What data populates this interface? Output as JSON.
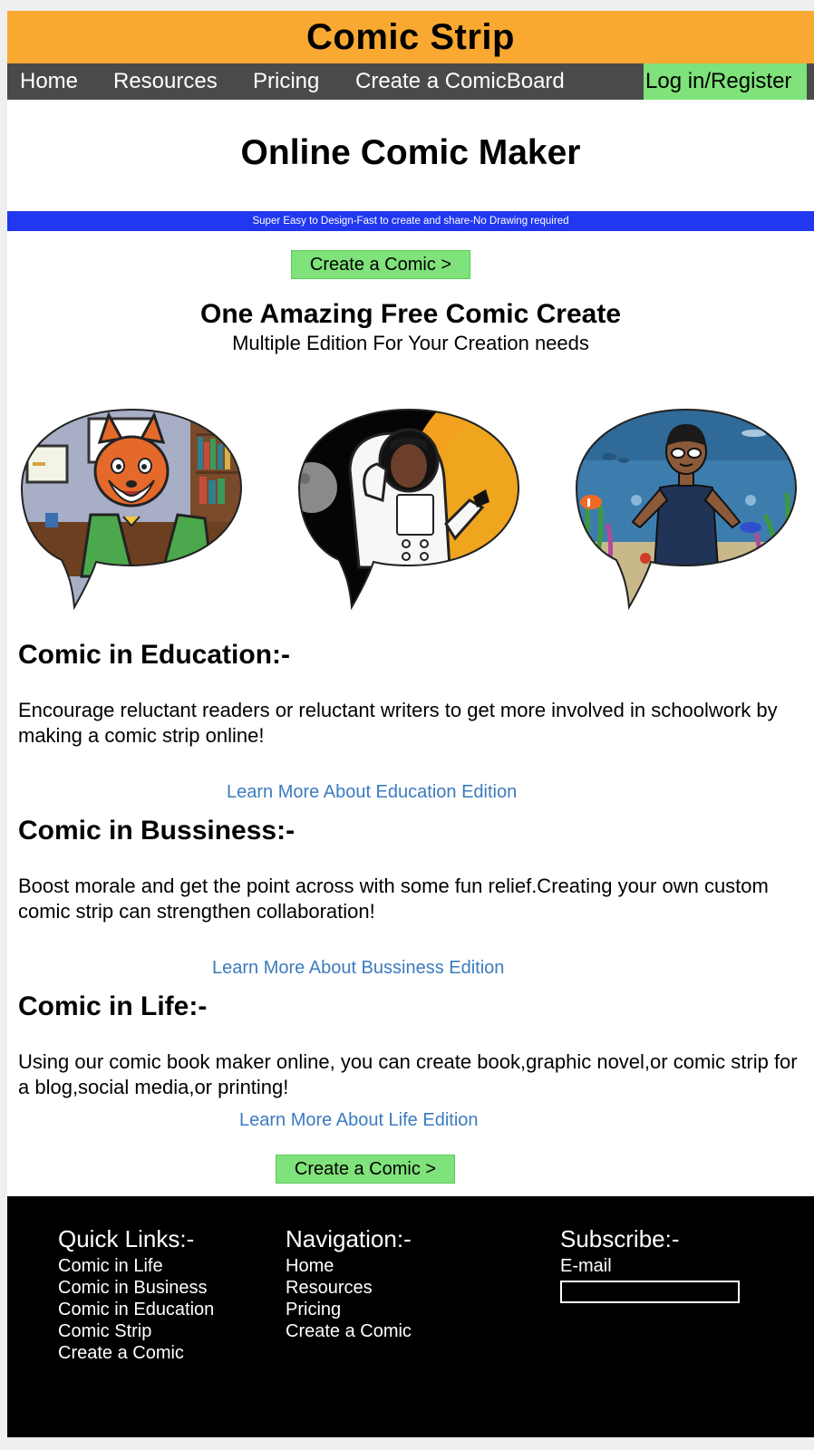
{
  "site_title": "Comic Strip",
  "nav": {
    "home": "Home",
    "resources": "Resources",
    "pricing": "Pricing",
    "create_board": "Create a ComicBoard",
    "login": "Log in/Register"
  },
  "hero": {
    "title": "Online Comic Maker",
    "tagline": "Super Easy to Design-Fast to create and share-No Drawing required",
    "cta": "Create a Comic >"
  },
  "intro": {
    "title": "One Amazing Free Comic Create",
    "subtitle": "Multiple Edition For Your Creation needs"
  },
  "categories": {
    "education": {
      "heading": "Comic in Education:-",
      "text": "Encourage reluctant readers or reluctant writers to get more involved in schoolwork by making a comic strip online!",
      "link": "Learn More About Education Edition"
    },
    "business": {
      "heading": "Comic in Bussiness:-",
      "text": "Boost morale and get the point across with some fun relief.Creating your own custom comic strip can strengthen collaboration!",
      "link": "Learn More About Bussiness Edition"
    },
    "life": {
      "heading": "Comic in Life:-",
      "text": "Using our comic book maker online, you can create book,graphic novel,or comic strip for a blog,social media,or printing!",
      "link": "Learn More About Life Edition"
    }
  },
  "bottom_cta": "Create a Comic >",
  "footer": {
    "quick_links": {
      "heading": "Quick Links:-",
      "items": [
        "Comic in Life",
        "Comic in Business",
        "Comic in Education",
        "Comic Strip",
        "Create a Comic"
      ]
    },
    "navigation": {
      "heading": "Navigation:-",
      "items": [
        "Home",
        "Resources",
        "Pricing",
        "Create a Comic"
      ]
    },
    "subscribe": {
      "heading": "Subscribe:-",
      "email_label": "E-mail"
    }
  },
  "colors": {
    "banner": "#f9a931",
    "navbar": "#4a4a4a",
    "login_bg": "#7fe27a",
    "tagline_bg": "#2138f0",
    "link": "#3b7bbf",
    "footer": "#000000"
  },
  "illustrations": [
    "fox-teacher-speech-bubble",
    "astronaut-speech-bubble",
    "swimmer-underwater-speech-bubble"
  ]
}
